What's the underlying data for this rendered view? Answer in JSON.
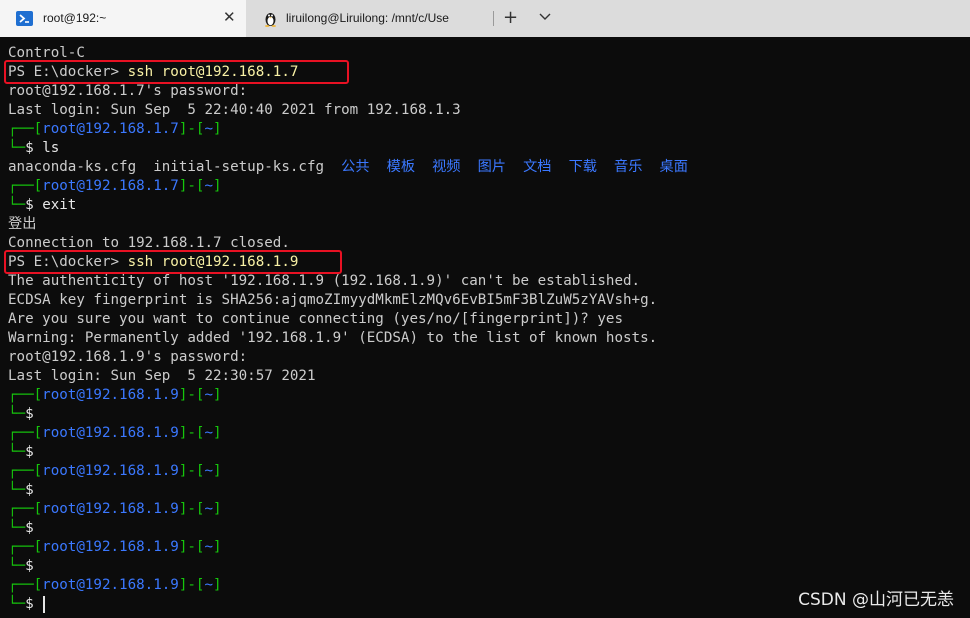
{
  "tabs": [
    {
      "label": "root@192:~",
      "close": "✕",
      "icon": "powershell-icon"
    },
    {
      "label": "liruilong@Liruilong: /mnt/c/Use",
      "icon": "linux-penguin-icon"
    }
  ],
  "toolbar": {
    "new_tab": "+",
    "dropdown_icon": "chevron-down-icon"
  },
  "terminal": {
    "lines": [
      "Control-C",
      "PS E:\\docker> ",
      "root@192.168.1.7's password:",
      "Last login: Sun Sep  5 22:40:40 2021 from 192.168.1.3",
      "ls",
      "anaconda-ks.cfg  initial-setup-ks.cfg",
      "exit",
      "登出",
      "Connection to 192.168.1.7 closed.",
      "PS E:\\docker> ",
      "The authenticity of host '192.168.1.9 (192.168.1.9)' can't be established.",
      "ECDSA key fingerprint is SHA256:ajqmoZImyydMkmElzMQv6EvBI5mF3BlZuW5zYAVsh+g.",
      "Are you sure you want to continue connecting (yes/no/[fingerprint])? yes",
      "Warning: Permanently added '192.168.1.9' (ECDSA) to the list of known hosts.",
      "root@192.168.1.9's password:",
      "Last login: Sun Sep  5 22:30:57 2021"
    ],
    "cmd_ssh1": "ssh root@192.168.1.7",
    "cmd_ssh2": "ssh root@192.168.1.9",
    "prompt_host1": "root@192.168.1.7",
    "prompt_host2": "root@192.168.1.9",
    "tilde": "~",
    "dollar": "$",
    "directories": [
      "公共",
      "模板",
      "视频",
      "图片",
      "文档",
      "下载",
      "音乐",
      "桌面"
    ]
  },
  "watermark": "CSDN @山河已无恙",
  "colors": {
    "highlight_box": "#e81123",
    "prompt_green": "#16c60c",
    "prompt_blue": "#3b78ff",
    "command_yellow": "#f9f1a5"
  }
}
